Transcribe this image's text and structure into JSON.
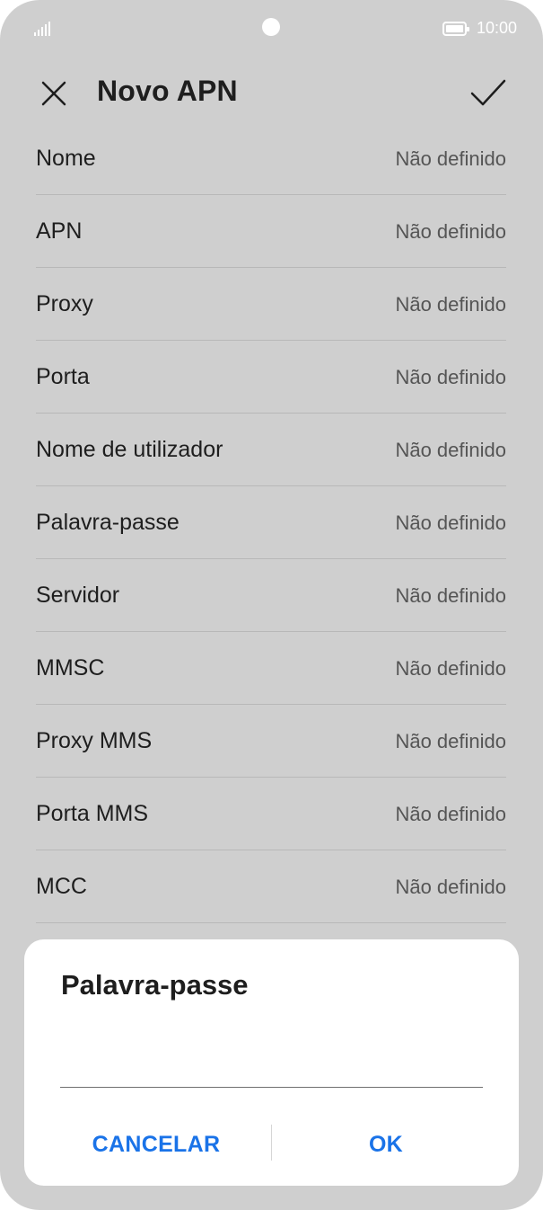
{
  "status_bar": {
    "time": "10:00",
    "icons": [
      "signal-icon",
      "camera-cutout",
      "battery-icon"
    ]
  },
  "header": {
    "title": "Novo APN",
    "close_icon": "close-icon",
    "confirm_icon": "checkmark-icon"
  },
  "fields": [
    {
      "label": "Nome",
      "value": "Não definido"
    },
    {
      "label": "APN",
      "value": "Não definido"
    },
    {
      "label": "Proxy",
      "value": "Não definido"
    },
    {
      "label": "Porta",
      "value": "Não definido"
    },
    {
      "label": "Nome de utilizador",
      "value": "Não definido"
    },
    {
      "label": "Palavra-passe",
      "value": "Não definido"
    },
    {
      "label": "Servidor",
      "value": "Não definido"
    },
    {
      "label": "MMSC",
      "value": "Não definido"
    },
    {
      "label": "Proxy MMS",
      "value": "Não definido"
    },
    {
      "label": "Porta MMS",
      "value": "Não definido"
    },
    {
      "label": "MCC",
      "value": "Não definido"
    }
  ],
  "dialog": {
    "title": "Palavra-passe",
    "input_value": "",
    "cancel_label": "CANCELAR",
    "ok_label": "OK"
  },
  "colors": {
    "accent": "#1a73e8",
    "background_dimmed": "#cfcfcf",
    "dialog_background": "#ffffff"
  }
}
